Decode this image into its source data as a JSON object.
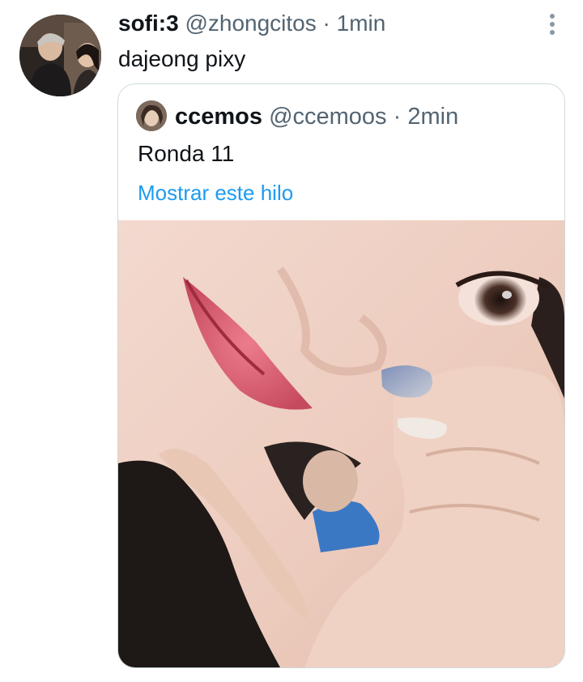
{
  "tweet": {
    "display_name": "sofi:3",
    "handle": "@zhongcitos",
    "separator": "·",
    "time": "1min",
    "text": "dajeong pixy",
    "more_icon": "more-vertical-icon"
  },
  "quote": {
    "display_name": "ccemos",
    "handle": "@ccemoos",
    "separator": "·",
    "time": "2min",
    "text": "Ronda 11",
    "show_thread": "Mostrar este hilo"
  },
  "colors": {
    "text": "#0f1419",
    "muted": "#536471",
    "link": "#1d9bf0",
    "border": "#cfd9de"
  }
}
